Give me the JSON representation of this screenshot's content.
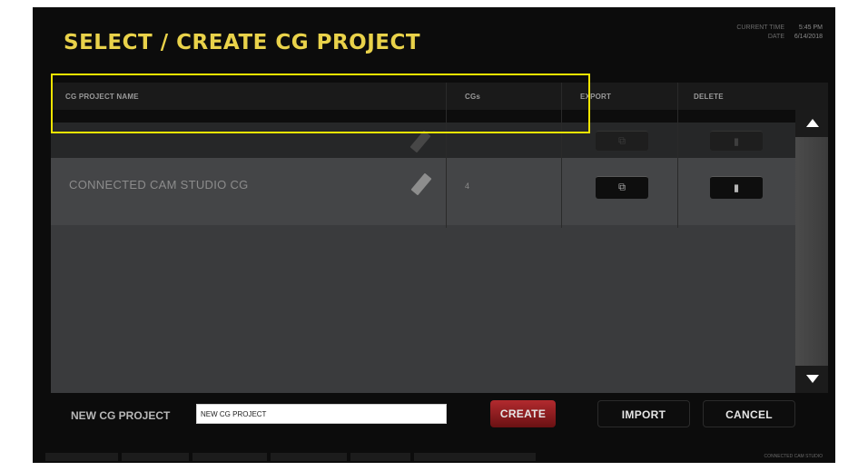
{
  "header": {
    "title": "SELECT / CREATE CG PROJECT",
    "clock": {
      "time_label": "CURRENT TIME",
      "time_value": "5:45 PM",
      "date_label": "DATE",
      "date_value": "6/14/2018"
    }
  },
  "table": {
    "columns": [
      "CG PROJECT NAME",
      "CGs",
      "EXPORT",
      "DELETE"
    ],
    "rows": [
      {
        "name": "",
        "count": ""
      },
      {
        "name": "CONNECTED CAM STUDIO CG",
        "count": "4"
      }
    ]
  },
  "icons": {
    "edit": "pencil-icon",
    "export": "export-icon",
    "delete": "trash-icon",
    "scroll_up": "arrow-up-icon",
    "scroll_down": "arrow-down-icon"
  },
  "footer": {
    "new_label": "NEW CG PROJECT",
    "new_value": "NEW CG PROJECT",
    "create_label": "CREATE",
    "import_label": "IMPORT",
    "cancel_label": "CANCEL"
  },
  "status": {
    "brand": "CONNECTED CAM STUDIO"
  },
  "colors": {
    "accent_title": "#e9d24a",
    "create_red": "#b22a2e",
    "highlight": "#f3e500"
  }
}
